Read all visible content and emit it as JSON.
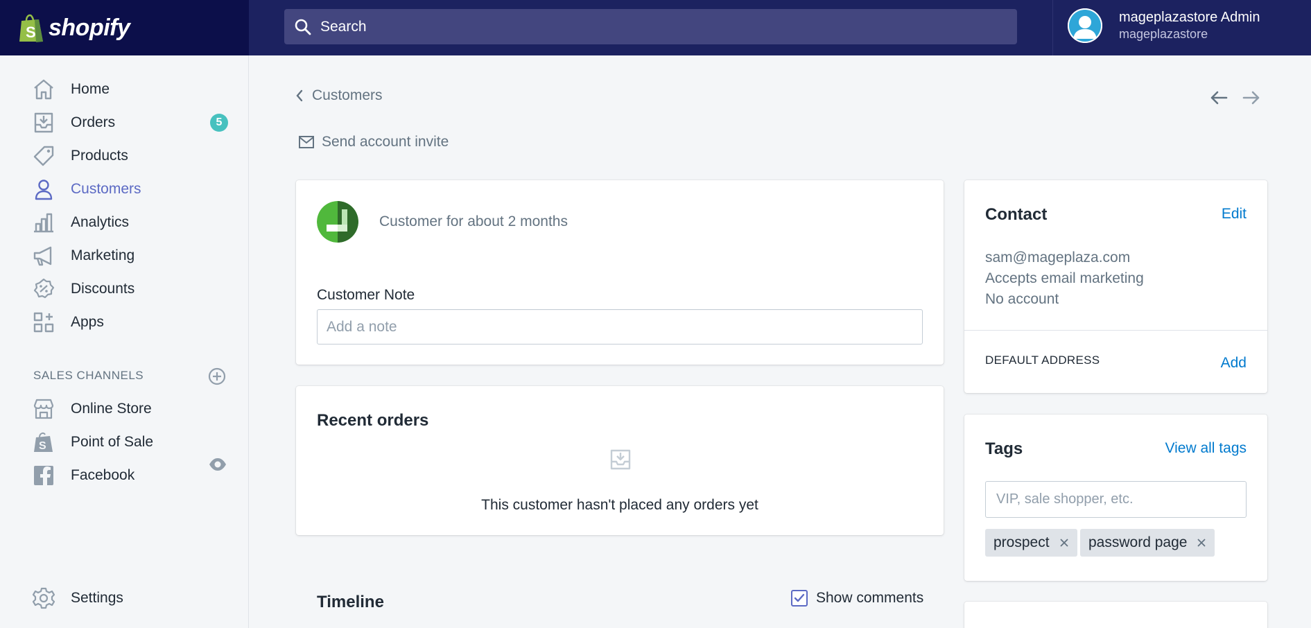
{
  "topbar": {
    "brand": "shopify",
    "search_placeholder": "Search",
    "user_name": "mageplazastore Admin",
    "user_store": "mageplazastore"
  },
  "sidebar": {
    "items": [
      {
        "label": "Home",
        "icon": "home-icon"
      },
      {
        "label": "Orders",
        "icon": "orders-icon",
        "badge": "5"
      },
      {
        "label": "Products",
        "icon": "products-icon"
      },
      {
        "label": "Customers",
        "icon": "customers-icon",
        "active": true
      },
      {
        "label": "Analytics",
        "icon": "analytics-icon"
      },
      {
        "label": "Marketing",
        "icon": "marketing-icon"
      },
      {
        "label": "Discounts",
        "icon": "discounts-icon"
      },
      {
        "label": "Apps",
        "icon": "apps-icon"
      }
    ],
    "sales_channels_title": "SALES CHANNELS",
    "channels": [
      {
        "label": "Online Store",
        "icon": "online-store-icon"
      },
      {
        "label": "Point of Sale",
        "icon": "point-of-sale-icon"
      },
      {
        "label": "Facebook",
        "icon": "facebook-icon"
      }
    ],
    "settings_label": "Settings"
  },
  "main": {
    "breadcrumb": "Customers",
    "send_invite": "Send account invite",
    "customer_since": "Customer for about 2 months",
    "note_label": "Customer Note",
    "note_placeholder": "Add a note",
    "recent_orders_title": "Recent orders",
    "recent_orders_empty": "This customer hasn't placed any orders yet",
    "timeline_title": "Timeline",
    "show_comments": "Show comments"
  },
  "contact": {
    "title": "Contact",
    "edit": "Edit",
    "email": "sam@mageplaza.com",
    "marketing": "Accepts email marketing",
    "account": "No account",
    "default_address": "DEFAULT ADDRESS",
    "add": "Add"
  },
  "tags": {
    "title": "Tags",
    "view_all": "View all tags",
    "placeholder": "VIP, sale shopper, etc.",
    "items": [
      "prospect",
      "password page"
    ]
  },
  "colors": {
    "brand_dark": "#0c0f4a",
    "topbar": "#1c2260",
    "accent": "#5c6ac4",
    "link": "#007ace",
    "badge": "#47c1bf"
  }
}
